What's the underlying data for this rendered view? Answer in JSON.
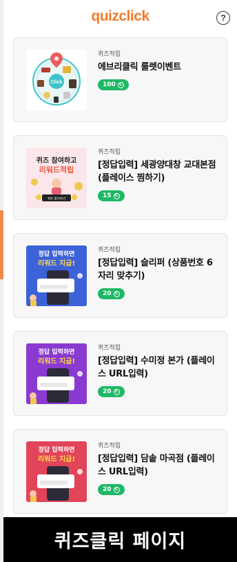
{
  "header": {
    "logo": "quizclick",
    "help_label": "?"
  },
  "items": [
    {
      "category": "퀴즈적립",
      "title": "에브리클릭 룰렛이벤트",
      "reward": "100",
      "thumb": {
        "type": "roulette",
        "text": "Click"
      }
    },
    {
      "category": "퀴즈적립",
      "title": "[정답입력] 세광양대창 교대본점 (플레이스 찜하기)",
      "reward": "15",
      "thumb": {
        "type": "quiz",
        "line1": "퀴즈 참여하고",
        "line2": "리워드적립",
        "button": "퀴즈 참가하기"
      }
    },
    {
      "category": "퀴즈적립",
      "title": "[정답입력] 슬리퍼 (상품번호 6자리 맞추기)",
      "reward": "20",
      "thumb": {
        "type": "answer",
        "bg": "#3c62d8",
        "line1": "정답 입력하면",
        "line2": "리워드 지급!"
      }
    },
    {
      "category": "퀴즈적립",
      "title": "[정답입력] 수미정 본가 (플레이스 URL입력)",
      "reward": "20",
      "thumb": {
        "type": "answer",
        "bg": "#8a3ad0",
        "line1": "정답 입력하면",
        "line2": "리워드 지급!"
      }
    },
    {
      "category": "퀴즈적립",
      "title": "[정답입력] 담솥 마곡점 (플레이스 URL입력)",
      "reward": "20",
      "thumb": {
        "type": "answer",
        "bg": "#e2445a",
        "line1": "정답 입력하면",
        "line2": "리워드 지급!"
      }
    }
  ],
  "coin_symbol": "C",
  "caption": "퀴즈클릭 페이지",
  "colors": {
    "brand": "#f07b2e",
    "reward_badge": "#1fb866",
    "card_bg": "#f7f7f7"
  }
}
